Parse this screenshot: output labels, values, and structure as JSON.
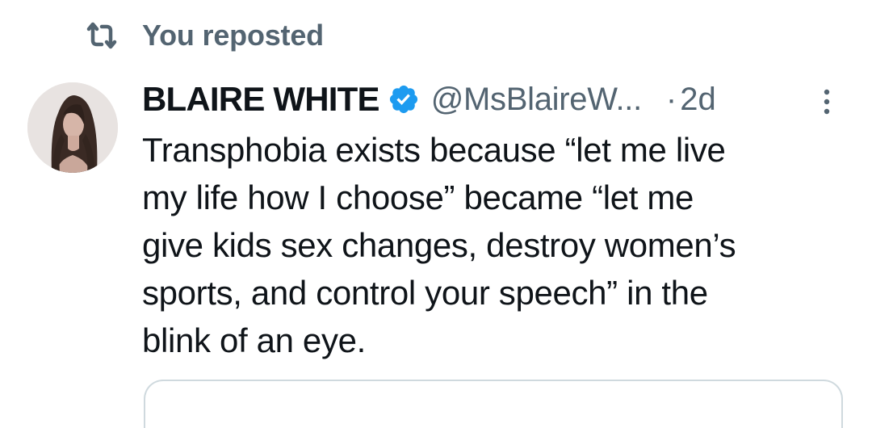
{
  "repost": {
    "label": "You reposted",
    "icon": "repost-icon"
  },
  "tweet": {
    "author": {
      "display_name": "BLAIRE WHITE",
      "verified": true,
      "handle": "@MsBlaireW...",
      "avatar_icon": "avatar"
    },
    "separator": "·",
    "time": "2d",
    "text": "Transphobia exists because “let me live\nmy life how I choose” became “let me\ngive kids sex changes, destroy women’s\nsports, and control your speech” in the\nblink of an eye.",
    "more_icon": "more-icon"
  },
  "colors": {
    "primary_text": "#0f1419",
    "secondary_text": "#536471",
    "verified_blue": "#1d9bf0",
    "border": "#cfd9de"
  }
}
